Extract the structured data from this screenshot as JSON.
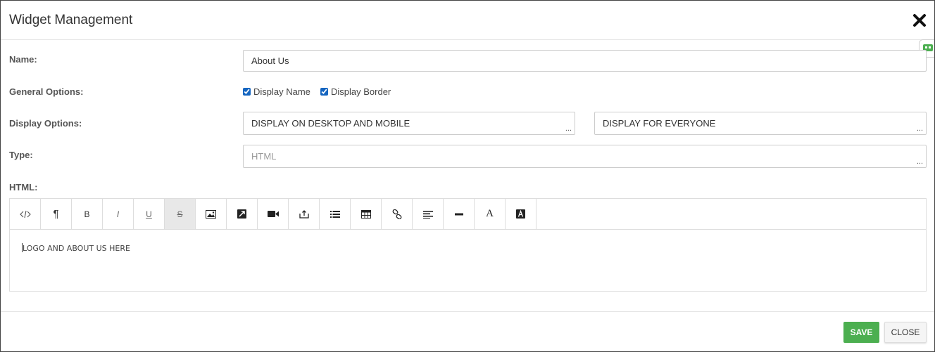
{
  "modal": {
    "title": "Widget Management",
    "close_icon": "close-icon"
  },
  "form": {
    "name_label": "Name:",
    "name_value": "About Us",
    "general_label": "General Options:",
    "display_name_label": "Display Name",
    "display_name_checked": true,
    "display_border_label": "Display Border",
    "display_border_checked": true,
    "display_options_label": "Display Options:",
    "display_device_value": "DISPLAY ON DESKTOP AND MOBILE",
    "display_audience_value": "DISPLAY FOR EVERYONE",
    "type_label": "Type:",
    "type_value": "HTML",
    "ellipsis": "...",
    "html_label": "HTML:"
  },
  "editor": {
    "toolbar": [
      {
        "name": "code-view-icon",
        "glyph": "</>"
      },
      {
        "name": "paragraph-icon",
        "glyph": "¶"
      },
      {
        "name": "bold-icon",
        "glyph": "B"
      },
      {
        "name": "italic-icon",
        "glyph": "I"
      },
      {
        "name": "underline-icon",
        "glyph": "U"
      },
      {
        "name": "strikethrough-icon",
        "glyph": "S"
      },
      {
        "name": "image-icon",
        "glyph": "img"
      },
      {
        "name": "image-link-icon",
        "glyph": "imglink"
      },
      {
        "name": "video-icon",
        "glyph": "video"
      },
      {
        "name": "embed-icon",
        "glyph": "embed"
      },
      {
        "name": "list-icon",
        "glyph": "list"
      },
      {
        "name": "table-icon",
        "glyph": "table"
      },
      {
        "name": "link-icon",
        "glyph": "link"
      },
      {
        "name": "align-left-icon",
        "glyph": "align"
      },
      {
        "name": "horizontal-rule-icon",
        "glyph": "hr"
      },
      {
        "name": "font-icon",
        "glyph": "A"
      },
      {
        "name": "font-color-icon",
        "glyph": "A"
      }
    ],
    "content": "LOGO AND ABOUT US HERE"
  },
  "footer": {
    "save_label": "SAVE",
    "close_label": "CLOSE"
  },
  "colors": {
    "save_bg": "#4caf50",
    "side_widget": "#4caf50"
  }
}
